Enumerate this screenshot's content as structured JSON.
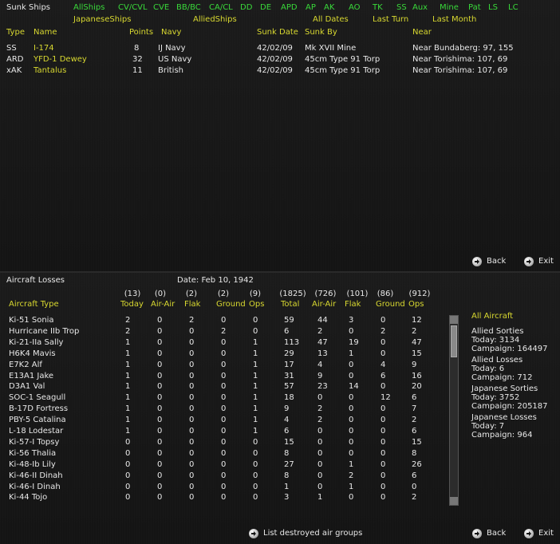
{
  "sunk": {
    "title": "Sunk Ships",
    "filters_row1": [
      "AllShips",
      "CV/CVL",
      "CVE",
      "BB/BC",
      "CA/CL",
      "DD",
      "DE",
      "APD",
      "AP",
      "AK",
      "AO",
      "TK",
      "SS",
      "Aux",
      "Mine",
      "Pat",
      "LS",
      "LC"
    ],
    "filters_row2": [
      "JapaneseShips",
      "AlliedShips",
      "All Dates",
      "Last Turn",
      "Last Month"
    ],
    "headers": [
      "Type",
      "Name",
      "Points",
      "Navy",
      "Sunk Date",
      "Sunk By",
      "Near"
    ],
    "rows": [
      [
        "SS",
        "I-174",
        "8",
        "IJ Navy",
        "42/02/09",
        "Mk XVII Mine",
        "Near Bundaberg: 97, 155"
      ],
      [
        "ARD",
        "YFD-1 Dewey",
        "32",
        "US Navy",
        "42/02/09",
        "45cm Type 91 Torp",
        "Near Torishima: 107, 69"
      ],
      [
        "xAK",
        "Tantalus",
        "11",
        "British",
        "42/02/09",
        "45cm Type 91 Torp",
        "Near Torishima: 107, 69"
      ]
    ],
    "back_label": "Back",
    "exit_label": "Exit"
  },
  "losses": {
    "title": "Aircraft Losses",
    "date": "Date: Feb 10, 1942",
    "header_counts": [
      "(13)",
      "(0)",
      "(2)",
      "(2)",
      "(9)",
      "(1825)",
      "(726)",
      "(101)",
      "(86)",
      "(912)"
    ],
    "headers": [
      "Aircraft Type",
      "Today",
      "Air-Air",
      "Flak",
      "Ground",
      "Ops",
      "Total",
      "Air-Air",
      "Flak",
      "Ground",
      "Ops"
    ],
    "rows": [
      [
        "Ki-51 Sonia",
        "2",
        "0",
        "2",
        "0",
        "0",
        "59",
        "44",
        "3",
        "0",
        "12"
      ],
      [
        "Hurricane IIb Trop",
        "2",
        "0",
        "0",
        "2",
        "0",
        "6",
        "2",
        "0",
        "2",
        "2"
      ],
      [
        "Ki-21-IIa Sally",
        "1",
        "0",
        "0",
        "0",
        "1",
        "113",
        "47",
        "19",
        "0",
        "47"
      ],
      [
        "H6K4 Mavis",
        "1",
        "0",
        "0",
        "0",
        "1",
        "29",
        "13",
        "1",
        "0",
        "15"
      ],
      [
        "E7K2 Alf",
        "1",
        "0",
        "0",
        "0",
        "1",
        "17",
        "4",
        "0",
        "4",
        "9"
      ],
      [
        "E13A1 Jake",
        "1",
        "0",
        "0",
        "0",
        "1",
        "31",
        "9",
        "0",
        "6",
        "16"
      ],
      [
        "D3A1 Val",
        "1",
        "0",
        "0",
        "0",
        "1",
        "57",
        "23",
        "14",
        "0",
        "20"
      ],
      [
        "SOC-1 Seagull",
        "1",
        "0",
        "0",
        "0",
        "1",
        "18",
        "0",
        "0",
        "12",
        "6"
      ],
      [
        "B-17D Fortress",
        "1",
        "0",
        "0",
        "0",
        "1",
        "9",
        "2",
        "0",
        "0",
        "7"
      ],
      [
        "PBY-5 Catalina",
        "1",
        "0",
        "0",
        "0",
        "1",
        "4",
        "2",
        "0",
        "0",
        "2"
      ],
      [
        "L-18 Lodestar",
        "1",
        "0",
        "0",
        "0",
        "1",
        "6",
        "0",
        "0",
        "0",
        "6"
      ],
      [
        "Ki-57-I Topsy",
        "0",
        "0",
        "0",
        "0",
        "0",
        "15",
        "0",
        "0",
        "0",
        "15"
      ],
      [
        "Ki-56 Thalia",
        "0",
        "0",
        "0",
        "0",
        "0",
        "8",
        "0",
        "0",
        "0",
        "8"
      ],
      [
        "Ki-48-Ib Lily",
        "0",
        "0",
        "0",
        "0",
        "0",
        "27",
        "0",
        "1",
        "0",
        "26"
      ],
      [
        "Ki-46-II Dinah",
        "0",
        "0",
        "0",
        "0",
        "0",
        "8",
        "0",
        "2",
        "0",
        "6"
      ],
      [
        "Ki-46-I Dinah",
        "0",
        "0",
        "0",
        "0",
        "0",
        "1",
        "0",
        "1",
        "0",
        "0"
      ],
      [
        "Ki-44 Tojo",
        "0",
        "0",
        "0",
        "0",
        "0",
        "3",
        "1",
        "0",
        "0",
        "2"
      ]
    ],
    "side": {
      "filter": "All Aircraft",
      "blocks": [
        {
          "title": "Allied Sorties",
          "today": "Today:   3134",
          "campaign": "Campaign: 164497"
        },
        {
          "title": "Allied Losses",
          "today": "Today:   6",
          "campaign": "Campaign: 712"
        },
        {
          "title": "Japanese Sorties",
          "today": "Today:   3752",
          "campaign": "Campaign: 205187"
        },
        {
          "title": "Japanese Losses",
          "today": "Today:   7",
          "campaign": "Campaign: 964"
        }
      ]
    },
    "list_label": "List destroyed air groups",
    "back_label": "Back",
    "exit_label": "Exit"
  },
  "colors": {
    "green": "#39d93a",
    "yellow": "#d8d830",
    "text": "#e8e8e8",
    "bg": "#171717"
  }
}
